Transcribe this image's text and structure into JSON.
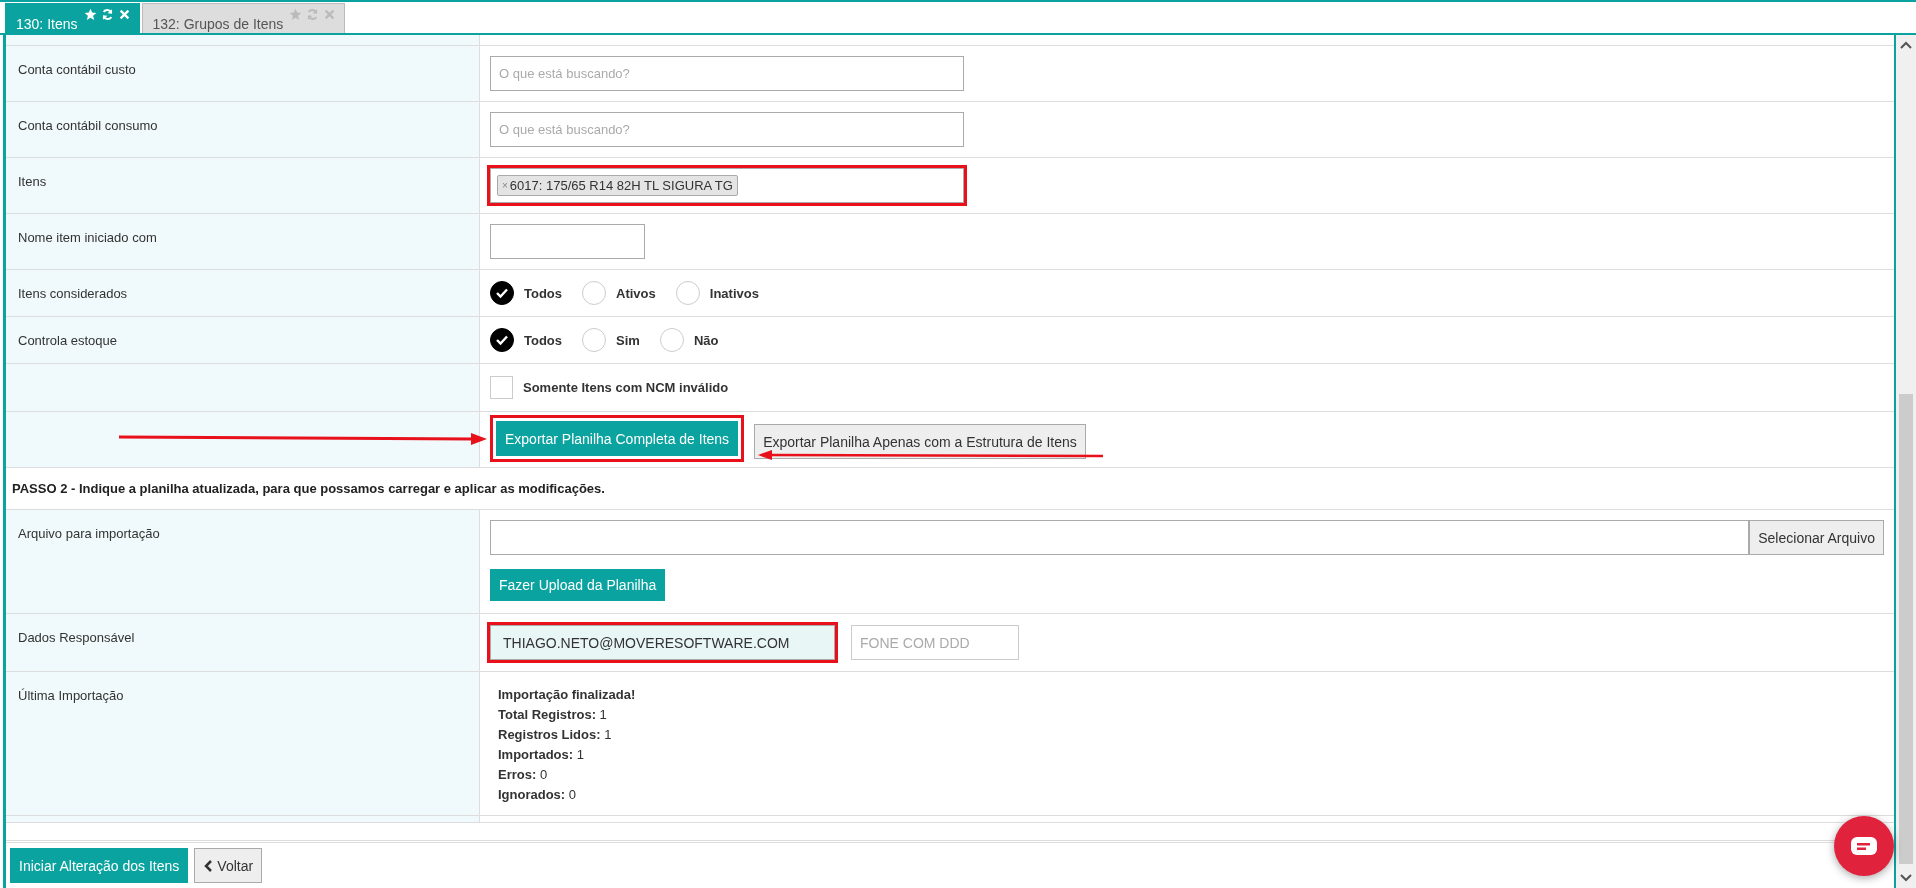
{
  "tabs": [
    {
      "label": "130: Itens",
      "selected": true
    },
    {
      "label": "132: Grupos de Itens",
      "selected": false
    }
  ],
  "form": [
    {
      "kind": "blank"
    },
    {
      "kind": "search",
      "label": "Conta contábil custo",
      "placeholder": "O que está buscando?"
    },
    {
      "kind": "search",
      "label": "Conta contábil consumo",
      "placeholder": "O que está buscando?"
    },
    {
      "kind": "tags",
      "label": "Itens",
      "highlighted": true,
      "tags": [
        {
          "remove": "×",
          "text": "6017: 175/65 R14 82H TL SIGURA TG"
        }
      ]
    },
    {
      "kind": "text",
      "label": "Nome item iniciado com"
    },
    {
      "kind": "radio",
      "label": "Itens considerados",
      "options": [
        {
          "label": "Todos",
          "selected": true
        },
        {
          "label": "Ativos",
          "selected": false
        },
        {
          "label": "Inativos",
          "selected": false
        }
      ]
    },
    {
      "kind": "radio",
      "label": "Controla estoque",
      "options": [
        {
          "label": "Todos",
          "selected": true
        },
        {
          "label": "Sim",
          "selected": false
        },
        {
          "label": "Não",
          "selected": false
        }
      ]
    },
    {
      "kind": "checkbox",
      "text": "Somente Itens com NCM inválido",
      "checked": false
    },
    {
      "kind": "buttons",
      "buttons": [
        {
          "label": "Exportar Planilha Completa de Itens",
          "primary": true,
          "highlighted": true,
          "arrow": {
            "kind": "from-left"
          }
        },
        {
          "label": "Exportar Planilha Apenas com a Estrutura de Itens",
          "primary": false,
          "highlighted": false,
          "arrow": {
            "kind": "over-from-right"
          }
        }
      ]
    },
    {
      "kind": "section",
      "text": "PASSO 2 - Indique a planilha atualizada, para que possamos carregar e aplicar as modificações."
    },
    {
      "kind": "file",
      "label": "Arquivo para importação",
      "pick": "Selecionar Arquivo",
      "upload": "Fazer Upload da Planilha"
    },
    {
      "kind": "contact",
      "label": "Dados Responsável",
      "email": "THIAGO.NETO@MOVERESOFTWARE.COM",
      "email_highlighted": true,
      "phone_placeholder": "FONE COM DDD"
    },
    {
      "kind": "result",
      "label": "Última Importação",
      "lines": [
        {
          "label": "Importação finalizada!"
        },
        {
          "label": "Total Registros:",
          "value": "1"
        },
        {
          "label": "Registros Lidos:",
          "value": "1"
        },
        {
          "label": "Importados:",
          "value": "1"
        },
        {
          "label": "Erros:",
          "value": "0"
        },
        {
          "label": "Ignorados:",
          "value": "0"
        }
      ]
    },
    {
      "kind": "blank"
    }
  ],
  "footer": {
    "primary": "Iniciar Alteração dos Itens",
    "back": "Voltar"
  }
}
